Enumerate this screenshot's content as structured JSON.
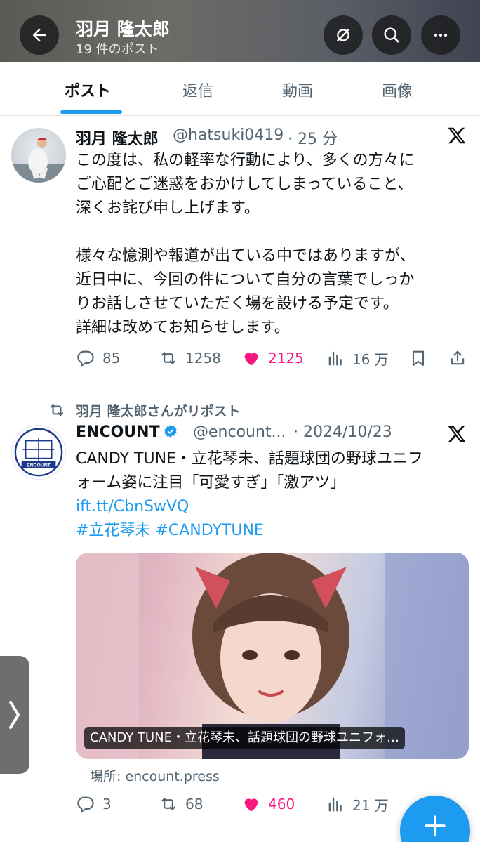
{
  "header": {
    "title": "羽月 隆太郎",
    "subtitle": "19 件のポスト",
    "icons": [
      "arrow-left-icon",
      "notification-off-icon",
      "search-icon",
      "more-icon"
    ]
  },
  "tabs": [
    {
      "label": "ポスト",
      "active": true
    },
    {
      "label": "返信",
      "active": false
    },
    {
      "label": "動画",
      "active": false
    },
    {
      "label": "画像",
      "active": false
    }
  ],
  "post1": {
    "name": "羽月 隆太郎",
    "handle": "@hatsuki0419",
    "time": "· 25 分",
    "lines": [
      "この度は、私の軽率な行動により、多くの方々に",
      "ご心配とご迷惑をおかけしてしまっていること、",
      "深くお詫び申し上げます。",
      "",
      "様々な憶測や報道が出ている中ではありますが、",
      "近日中に、今回の件について自分の言葉でしっか",
      "りお話しさせていただく場を設ける予定です。",
      "詳細は改めてお知らせします。"
    ],
    "replies": "85",
    "reposts": "1258",
    "likes": "2125",
    "views": "16 万"
  },
  "post2": {
    "repost_label": "羽月 隆太郎さんがリポスト",
    "name": "ENCOUNT",
    "handle": "@encount...",
    "time": "· 2024/10/23",
    "avatar_text": "ENCOUNT",
    "text_lines": [
      "CANDY TUNE・立花琴未、話題球団の野球ユニフ",
      "ォーム姿に注目「可愛すぎ」「激アツ」"
    ],
    "link": "ift.tt/CbnSwVQ",
    "hashtags": "#立花琴未 #CANDYTUNE",
    "media_caption": "CANDY TUNE・立花琴未、話題球団の野球ユニフォ…",
    "source": "場所: encount.press",
    "replies": "3",
    "reposts": "68",
    "likes": "460",
    "views": "21 万"
  },
  "colors": {
    "accent": "#1d9bf0",
    "like": "#f91880",
    "secondary_text": "#536471",
    "primary_text": "#0f1419"
  }
}
